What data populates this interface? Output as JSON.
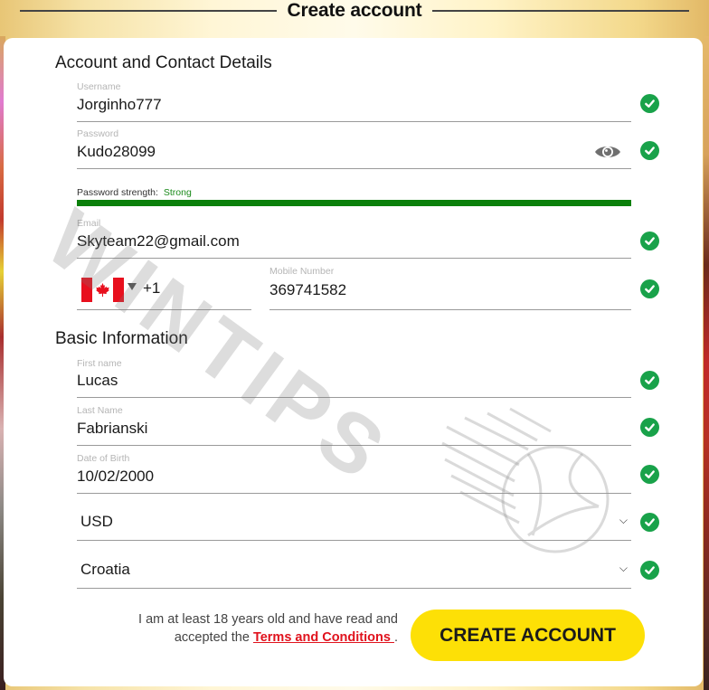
{
  "header": {
    "title": "Create account"
  },
  "sections": {
    "account": "Account and Contact Details",
    "basic": "Basic Information"
  },
  "fields": {
    "username": {
      "label": "Username",
      "value": "Jorginho777",
      "valid": true
    },
    "password": {
      "label": "Password",
      "value": "Kudo28099",
      "valid": true,
      "toggle_icon": "eye-icon"
    },
    "password_strength": {
      "label": "Password strength:",
      "value": "Strong",
      "level": 1.0,
      "color": "#0b800b"
    },
    "email": {
      "label": "Email",
      "value": "Skyteam22@gmail.com",
      "valid": true
    },
    "phone": {
      "country": "Canada",
      "flag": "canada-flag",
      "dial_code": "+1",
      "label": "Mobile Number",
      "value": "369741582",
      "valid": true
    },
    "first_name": {
      "label": "First name",
      "value": "Lucas",
      "valid": true
    },
    "last_name": {
      "label": "Last Name",
      "value": "Fabrianski",
      "valid": true
    },
    "dob": {
      "label": "Date of Birth",
      "value": "10/02/2000",
      "valid": true
    },
    "currency": {
      "value": "USD",
      "valid": true
    },
    "country": {
      "value": "Croatia",
      "valid": true
    }
  },
  "consent": {
    "text_before": "I am at least 18 years old and have read and accepted the ",
    "link": "Terms and Conditions ",
    "text_after": "."
  },
  "cta": {
    "label": "CREATE ACCOUNT",
    "color": "#fde006"
  },
  "watermark": {
    "text": "WINTIPS"
  },
  "colors": {
    "valid": "#19a24a",
    "link": "#e0121d"
  }
}
